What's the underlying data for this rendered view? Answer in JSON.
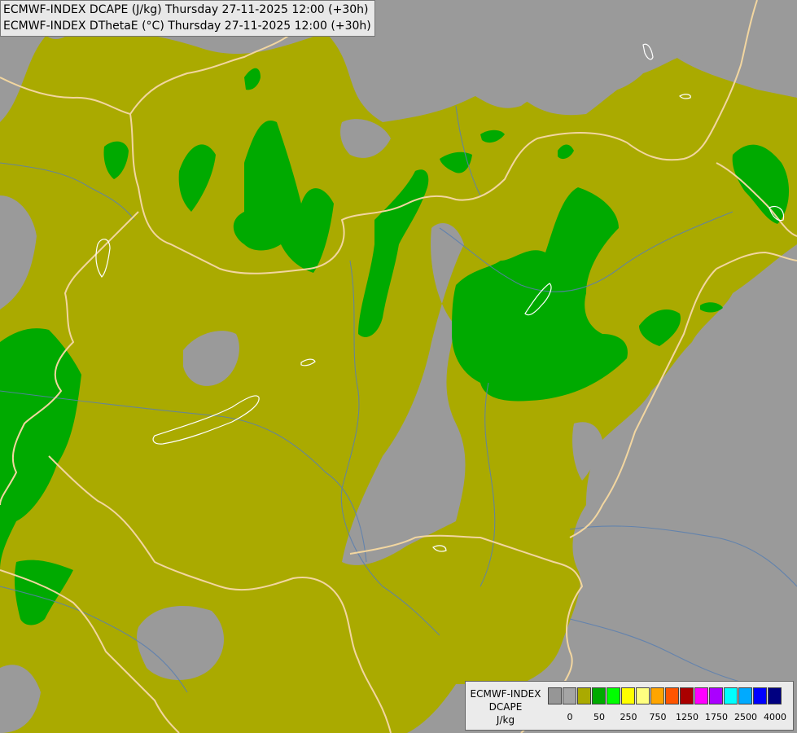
{
  "title": {
    "line1": "ECMWF-INDEX DCAPE (J/kg) Thursday 27-11-2025 12:00 (+30h)",
    "line2": "ECMWF-INDEX DThetaE (°C) Thursday 27-11-2025 12:00 (+30h)"
  },
  "legend": {
    "model": "ECMWF-INDEX",
    "parameter": "DCAPE",
    "unit": "J/kg",
    "swatch_colors": [
      "#969696",
      "#a5a5a5",
      "#aaaa00",
      "#00aa00",
      "#00ff00",
      "#ffff00",
      "#ffff80",
      "#ffa500",
      "#ff5500",
      "#aa0000",
      "#ff00ff",
      "#aa00ff",
      "#00ffff",
      "#00aaff",
      "#0000ff",
      "#000080"
    ],
    "tick_labels": [
      "0",
      "50",
      "250",
      "750",
      "1250",
      "1750",
      "2500",
      "4000"
    ]
  },
  "colors": {
    "background": "#9a9a9a",
    "olive": "#aaaa00",
    "green": "#00aa00",
    "border": "#f2d6a0",
    "river": "#5a7fb0",
    "lake": "#ffffff"
  }
}
